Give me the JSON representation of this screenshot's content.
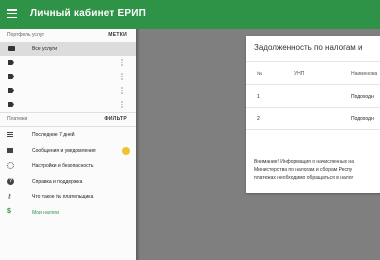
{
  "header": {
    "title": "Личный кабинет ЕРИП",
    "menu_icon": "hamburger-icon",
    "color": "#2e9347"
  },
  "portfolio": {
    "heading": "Портфель услуг",
    "tags_label": "МЕТКИ",
    "items": [
      {
        "label": "Все услуги",
        "icon": "briefcase-icon",
        "active": true
      },
      {
        "label": "",
        "icon": "tag-icon"
      },
      {
        "label": "",
        "icon": "tag-icon"
      },
      {
        "label": "",
        "icon": "tag-icon"
      },
      {
        "label": "",
        "icon": "tag-icon"
      }
    ]
  },
  "payments": {
    "heading": "Платежи",
    "filter_label": "ФИЛЬТР",
    "items": [
      {
        "label": "Последние 7 дней",
        "icon": "list-icon"
      },
      {
        "label": "Сообщения и уведомления",
        "icon": "mail-icon",
        "badge": "emoji-icon"
      },
      {
        "label": "Настройки и безопасность",
        "icon": "gear-icon"
      },
      {
        "label": "Справка и поддержка",
        "icon": "help-icon"
      },
      {
        "label": "Что такое № плательщика",
        "icon": "key-icon"
      },
      {
        "label": "Мои налоги",
        "icon": "dollar-icon"
      }
    ]
  },
  "card": {
    "title": "Задолженность по налогам и",
    "columns": [
      "№",
      "УНП",
      "Наименова"
    ],
    "rows": [
      {
        "num": "1",
        "unp": "",
        "name": "Подоходн"
      },
      {
        "num": "2",
        "unp": "",
        "name": "Подоходн"
      }
    ],
    "notice": [
      "Внимание! Информация о начисленных на",
      "Министерства по налогам и сборам Респу",
      "платежах необходимо обращаться в налог"
    ]
  }
}
